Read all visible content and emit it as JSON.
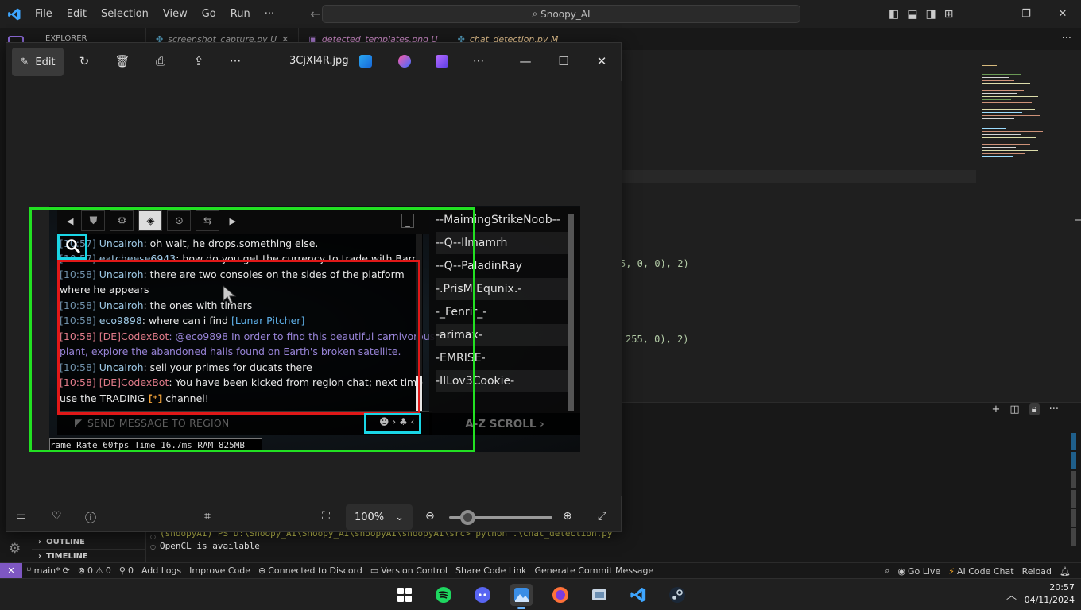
{
  "vscode": {
    "menu": [
      "File",
      "Edit",
      "Selection",
      "View",
      "Go",
      "Run",
      "···"
    ],
    "search_text": "Snoopy_AI",
    "sidebar": {
      "explorer_label": "EXPLORER",
      "outline_label": "OUTLINE",
      "timeline_label": "TIMELINE"
    },
    "tabs": [
      {
        "label": "screenshot_capture.py U",
        "icon": "python-icon"
      },
      {
        "label": "detected_templates.png U",
        "icon": "image-icon"
      },
      {
        "label": "chat_detection.py M",
        "icon": "python-icon"
      }
    ],
    "code_fragments": [
      {
        "text": "5, 0, 0), 2)"
      },
      {
        "text": "255, 0), 2)"
      }
    ],
    "terminal": {
      "prompt_line": "(snoopyAI) PS D:\\Snoopy_AI\\Snoopy_AI\\snoopyAI\\snoopyAI\\src> python .\\chat_detection.py",
      "output_line": "OpenCL is available",
      "cursor_line": ""
    },
    "statusbar": {
      "branch": "main*",
      "errors": "0",
      "warnings": "0",
      "ports": "0",
      "items_left": [
        "Add Logs",
        "Improve Code",
        "Connected to Discord",
        "Version Control",
        "Share Code Link",
        "Generate Commit Message"
      ],
      "go_live": "Go Live",
      "ai_chat": "AI Code Chat",
      "reload": "Reload"
    }
  },
  "photos": {
    "filename": "3CjXl4R.jpg",
    "edit_label": "Edit",
    "zoom_level": "100%",
    "zoom_fraction": 0.18
  },
  "game": {
    "chat_lines": [
      {
        "ts": "[10:57]",
        "name": "UncaIroh",
        "msg": ": oh wait, he drops.something else."
      },
      {
        "ts": "[10:57]",
        "name": "eatcheese6943",
        "msg": ": how do you get the currency to trade with Baro"
      },
      {
        "ts": "[10:58]",
        "name": "UncaIroh",
        "msg": ": there are two consoles on the sides of the platform"
      },
      {
        "ts": "",
        "name": "",
        "msg": "where he appears"
      },
      {
        "ts": "[10:58]",
        "name": "UncaIroh",
        "msg": ": the ones with timers"
      },
      {
        "ts": "[10:58]",
        "name": "eco9898",
        "msg": ": where can i find ",
        "link": "[Lunar Pitcher]"
      },
      {
        "ts": "[10:58]",
        "bot": "[DE]CodexBot",
        "purple": ": @eco9898 In order to find this beautiful carnivorous"
      },
      {
        "ts": "",
        "purple": "plant, explore the abandoned halls found on Earth's broken satellite."
      },
      {
        "ts": "[10:58]",
        "name": "UncaIroh",
        "msg": ": sell your primes for ducats there"
      },
      {
        "ts": "[10:58]",
        "bot": "[DE]CodexBot",
        "msg": ": You have been kicked from region chat; next time"
      },
      {
        "ts": "",
        "msg": "use the TRADING ",
        "msg2": " channel!"
      }
    ],
    "input_placeholder": "SEND MESSAGE TO REGION",
    "players": [
      "--MaimingStrikeNoob--",
      "--Q--Ilmamrh",
      "--Q--PaladinRay",
      "-.PrisM.Equnix.-",
      "-_Fenrir_-",
      "-arimax-",
      "-EMRISE-",
      "-IILov3Cookie-"
    ],
    "az_scroll": "A-Z SCROLL ›",
    "fps_text": "rame Rate 60fps Time 16.7ms RAM 825MB"
  },
  "taskbar": {
    "time": "20:57",
    "date": "04/11/2024"
  }
}
